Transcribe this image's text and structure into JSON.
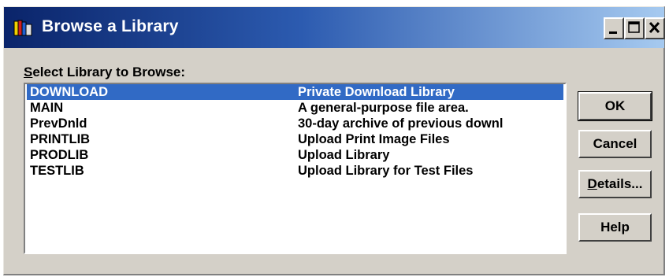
{
  "window": {
    "title": "Browse a Library",
    "icon": "library-app-icon"
  },
  "prompt": {
    "accel": "S",
    "rest": "elect Library to Browse:"
  },
  "libraries": [
    {
      "name": "DOWNLOAD",
      "description": "Private Download Library",
      "selected": true
    },
    {
      "name": "MAIN",
      "description": "A general-purpose file area.",
      "selected": false
    },
    {
      "name": "PrevDnld",
      "description": "30-day archive of previous downl",
      "selected": false
    },
    {
      "name": "PRINTLIB",
      "description": "Upload Print Image Files",
      "selected": false
    },
    {
      "name": "PRODLIB",
      "description": "Upload Library",
      "selected": false
    },
    {
      "name": "TESTLIB",
      "description": "Upload Library for Test Files",
      "selected": false
    }
  ],
  "buttons": {
    "ok": "OK",
    "cancel": "Cancel",
    "details_accel": "D",
    "details_rest": "etails...",
    "help": "Help"
  },
  "colors": {
    "title_start": "#0a246a",
    "title_end": "#a6caf0",
    "selection": "#316ac5",
    "face": "#d4d0c8"
  }
}
